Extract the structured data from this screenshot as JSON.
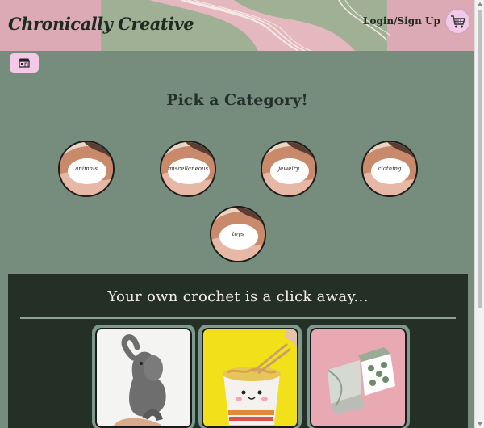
{
  "header": {
    "brand": "Chronically Creative",
    "login_label": "Login/Sign Up",
    "cart_icon": "cart-icon"
  },
  "shop_icon": "shop-icon",
  "categories_title": "Pick a Category!",
  "categories": [
    {
      "label": "animals"
    },
    {
      "label": "miscellaneous"
    },
    {
      "label": "jewelry"
    },
    {
      "label": "clothing"
    },
    {
      "label": "toys"
    }
  ],
  "showcase": {
    "tagline": "Your own crochet is a click away...",
    "products": [
      {
        "name": "crochet elephant"
      },
      {
        "name": "crochet noodle cup"
      },
      {
        "name": "crochet dice"
      }
    ]
  },
  "colors": {
    "background": "#768c7d",
    "dark_section": "#243026",
    "accent_pink": "#f2c9e6"
  }
}
